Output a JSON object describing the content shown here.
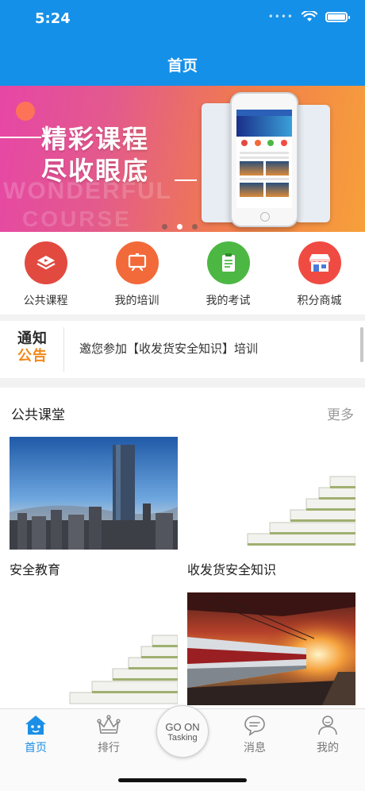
{
  "status_bar": {
    "time": "5:24",
    "signal": "••••"
  },
  "header": {
    "title": "首页"
  },
  "banner": {
    "headline_line1": "精彩课程",
    "headline_line2": "尽收眼底",
    "ghost_text_line1": "WONDERFUL",
    "ghost_text_line2": "COURSE",
    "page_count": 3,
    "active_page": 2
  },
  "quick_menu": [
    {
      "label": "公共课程",
      "icon": "video-course-icon",
      "color": "#e24a40"
    },
    {
      "label": "我的培训",
      "icon": "training-board-icon",
      "color": "#f26a3a"
    },
    {
      "label": "我的考试",
      "icon": "exam-clipboard-icon",
      "color": "#4cb843"
    },
    {
      "label": "积分商城",
      "icon": "store-icon",
      "color": "#f04b42"
    }
  ],
  "notice": {
    "logo_line1": "通知",
    "logo_line2": "公告",
    "text": "邀您参加【收发货安全知识】培训"
  },
  "public_class": {
    "title": "公共课堂",
    "more": "更多",
    "courses": [
      {
        "title": "安全教育",
        "image": "city-skyline"
      },
      {
        "title": "收发货安全知识",
        "image": "book-stack"
      },
      {
        "title": "",
        "image": "book-stack"
      },
      {
        "title": "",
        "image": "train-station"
      }
    ]
  },
  "tabbar": {
    "items": [
      {
        "label": "首页",
        "icon": "home-icon",
        "active": true
      },
      {
        "label": "排行",
        "icon": "crown-icon",
        "active": false
      },
      {
        "label": "消息",
        "icon": "message-icon",
        "active": false
      },
      {
        "label": "我的",
        "icon": "profile-icon",
        "active": false
      }
    ],
    "center_line1": "GO ON",
    "center_line2": "Tasking"
  },
  "colors": {
    "primary": "#1590e8",
    "active_tab": "#1b8fe6",
    "notice_orange": "#f18a1b"
  }
}
